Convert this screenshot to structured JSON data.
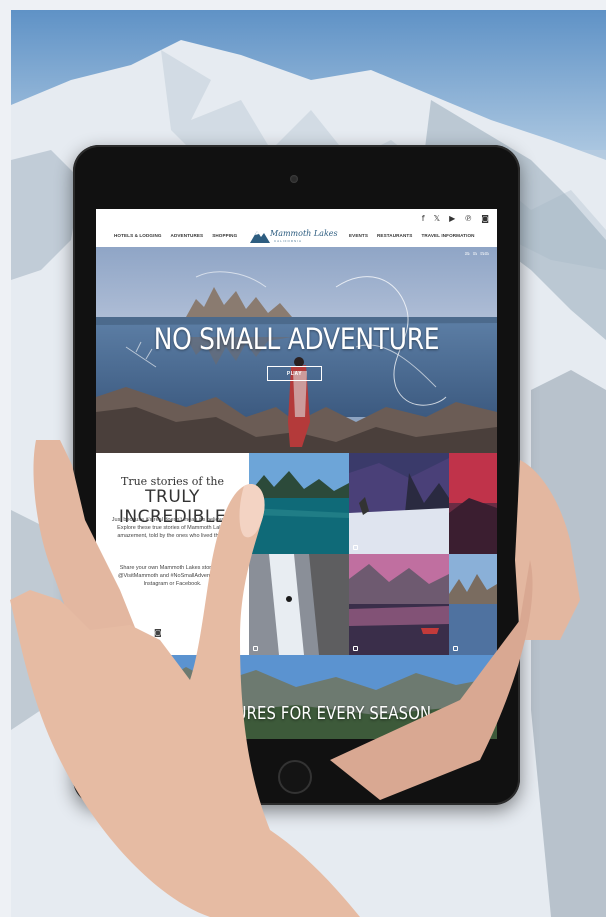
{
  "site": {
    "social": [
      "f",
      "𝕏",
      "▶",
      "℗",
      "◙"
    ],
    "nav_left": [
      "HOTELS & LODGING",
      "ADVENTURES",
      "SHOPPING"
    ],
    "nav_right": [
      "EVENTS",
      "RESTAURANTS",
      "TRAVEL INFORMATION"
    ],
    "logo": {
      "name": "Mammoth Lakes",
      "sub": "CALIFORNIA"
    }
  },
  "hero": {
    "corner_text": "ಡಾ ಠಾ ಠಾಠಾ",
    "headline": "NO SMALL ADVENTURE",
    "play_label": "PLAY"
  },
  "stories": {
    "kicker": "True stories of the",
    "title": "TRULY INCREDIBLE",
    "body": "Just because it's real doesn't mean it's believable. Explore these true stories of Mammoth Lakes amazement, told by the ones who lived them.",
    "share": "Share your own Mammoth Lakes story. Tag @VisitMammoth and #NoSmallAdventure on Instagram or Facebook.",
    "icon": "◙"
  },
  "seasons": {
    "headline": "ADVENTURES FOR EVERY SEASON"
  },
  "colors": {
    "sky": "#6f9cc9",
    "snow": "#e8edf2",
    "logo": "#2d5d80",
    "bezel": "#111111"
  }
}
